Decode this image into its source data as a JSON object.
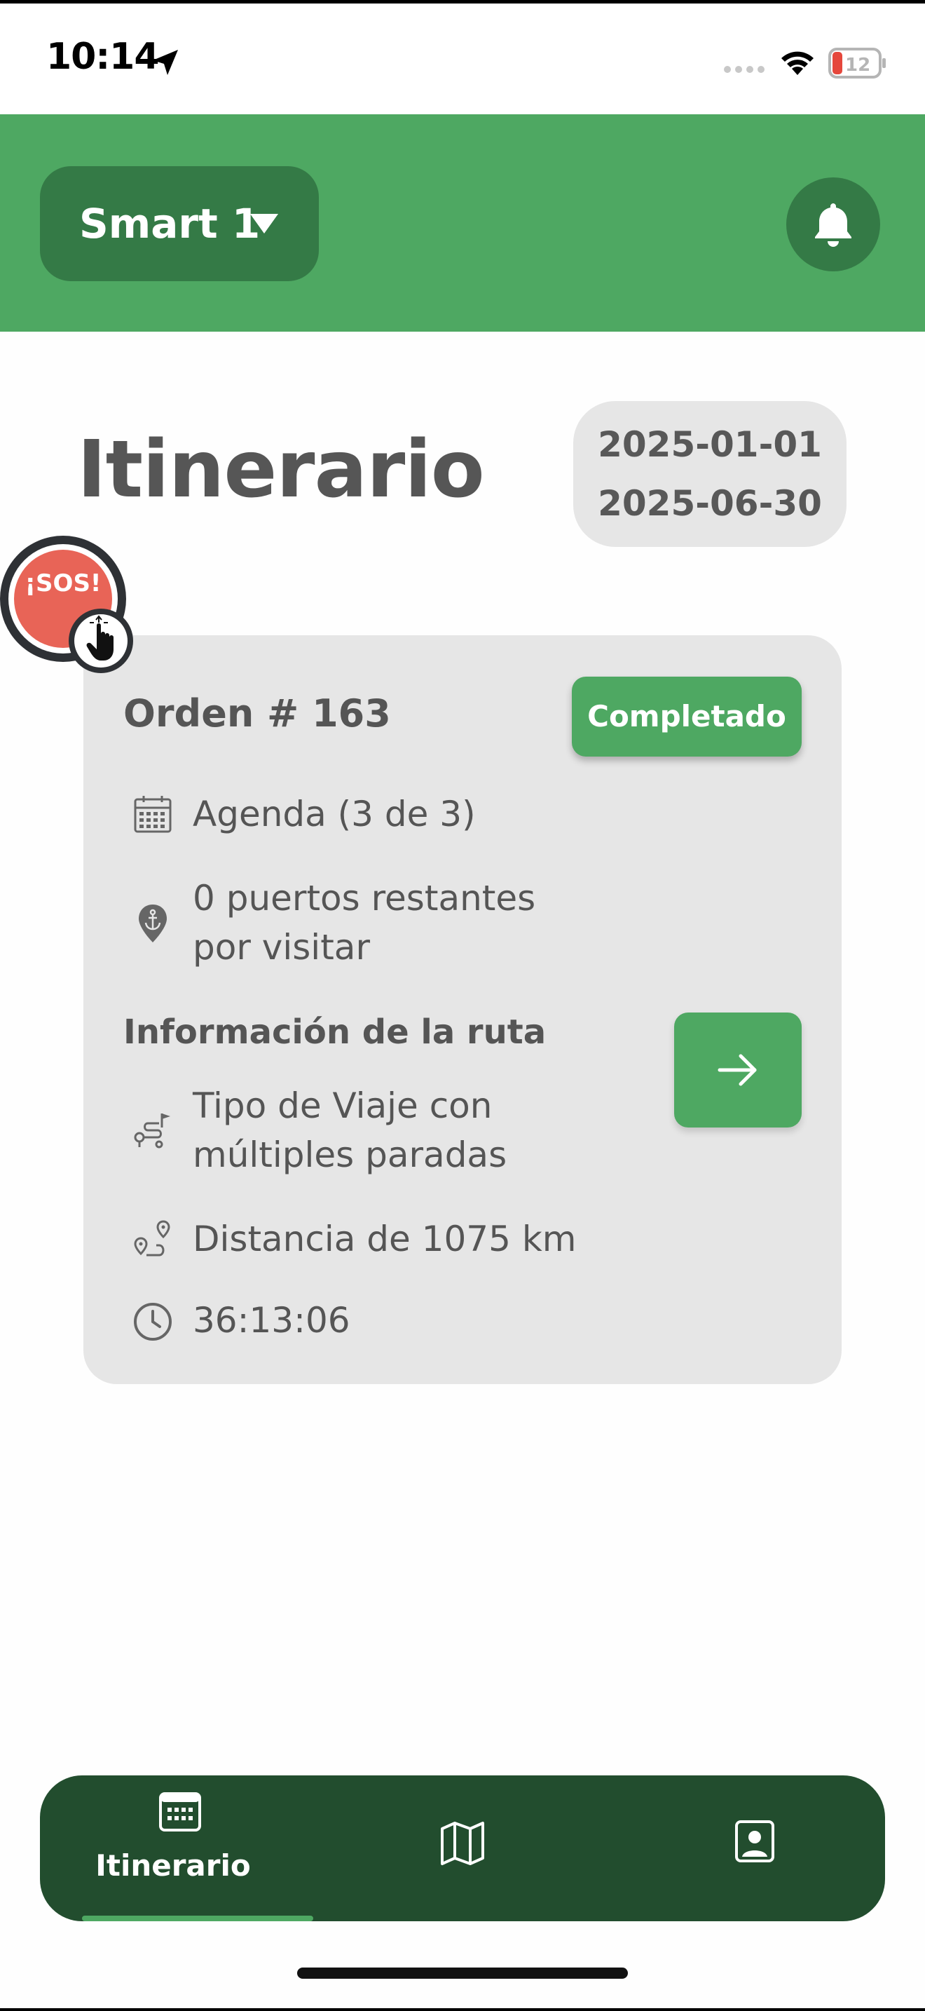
{
  "status_bar": {
    "time": "10:14",
    "battery_level": "12"
  },
  "header": {
    "vehicle_label": "Smart 1",
    "accent_color": "#4ea862",
    "dark_accent_color": "#347a46"
  },
  "page": {
    "title": "Itinerario",
    "date_start": "2025-01-01",
    "date_end": "2025-06-30"
  },
  "sos": {
    "label": "¡SOS!"
  },
  "order": {
    "title": "Orden # 163",
    "status": "Completado",
    "agenda": "Agenda (3 de 3)",
    "ports_line1": "0 puertos restantes",
    "ports_line2": "por visitar",
    "route_heading": "Información de la ruta",
    "trip_type_line1": "Tipo de Viaje con",
    "trip_type_line2": "múltiples paradas",
    "distance": "Distancia de 1075 km",
    "duration": "36:13:06"
  },
  "bottom_nav": {
    "tabs": [
      {
        "label": "Itinerario",
        "icon": "calendar-icon",
        "active": true
      },
      {
        "label": "",
        "icon": "map-icon",
        "active": false
      },
      {
        "label": "",
        "icon": "profile-icon",
        "active": false
      }
    ],
    "background_color": "#224d2e"
  }
}
